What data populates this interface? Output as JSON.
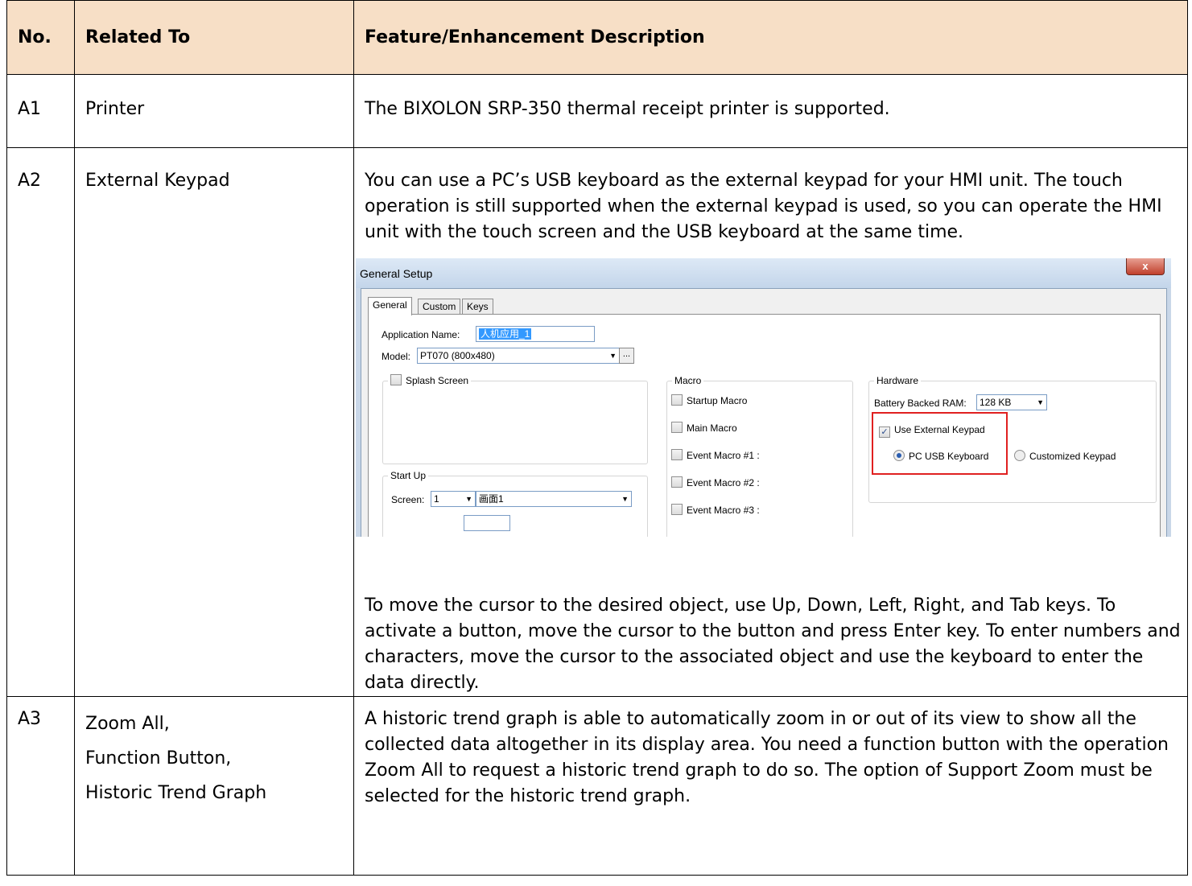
{
  "table": {
    "headers": [
      "No.",
      "Related To",
      "Feature/Enhancement Description"
    ],
    "rows": [
      {
        "no": "A1",
        "related": "Printer",
        "description": "The BIXOLON SRP-350 thermal receipt printer is supported."
      },
      {
        "no": "A2",
        "related": "External Keypad",
        "description": "You can use a PC’s USB keyboard as the external keypad for your HMI unit. The touch operation is still supported when the external keypad is used, so you can operate the HMI unit with the touch screen and the USB keyboard at the same time.",
        "description2": "To move the cursor to the desired object, use Up, Down, Left, Right, and Tab keys. To activate a button, move the cursor to the button and press Enter key. To enter numbers and characters, move the cursor to the associated object and use the keyboard to enter the data directly."
      },
      {
        "no": "A3",
        "related_lines": [
          "Zoom All,",
          "Function Button,",
          "Historic Trend Graph"
        ],
        "description": "A historic trend graph is able to automatically zoom in or out of its view to show all the collected data altogether in its display area. You need a function button with the operation Zoom All to request a historic trend graph to do so. The option of Support Zoom must be selected for the historic trend graph."
      }
    ]
  },
  "dialog": {
    "title": "General Setup",
    "close_label": "x",
    "tabs": [
      "General",
      "Custom",
      "Keys"
    ],
    "app_name_label": "Application Name:",
    "app_name_value": "人机应用_1",
    "model_label": "Model:",
    "model_value": "PT070 (800x480)",
    "ellipsis_label": "...",
    "splash_label": "Splash Screen",
    "startup_group": "Start Up",
    "screen_label": "Screen:",
    "screen_value": "1",
    "screen_name": "画面1",
    "macro_group": "Macro",
    "macros": [
      "Startup Macro",
      "Main Macro",
      "Event Macro #1 :",
      "Event Macro #2 :",
      "Event Macro #3 :"
    ],
    "hardware_group": "Hardware",
    "battery_label": "Battery Backed RAM:",
    "battery_value": "128 KB",
    "use_external_keypad": "Use External Keypad",
    "pc_usb_keyboard": "PC USB Keyboard",
    "customized_keypad": "Customized Keypad"
  },
  "colors": {
    "header_bg": "#f7dfc6",
    "highlight_border": "#e02020"
  }
}
